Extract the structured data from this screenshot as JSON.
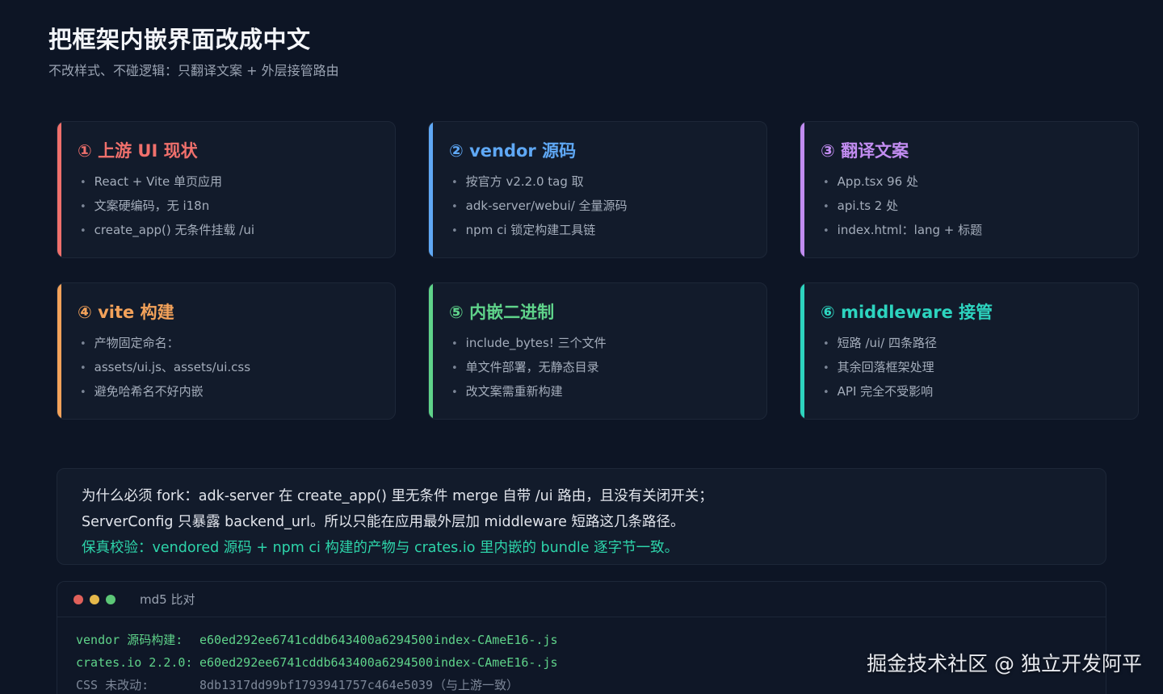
{
  "header": {
    "title": "把框架内嵌界面改成中文",
    "subtitle": "不改样式、不碰逻辑：只翻译文案 + 外层接管路由"
  },
  "cards": [
    {
      "title": "① 上游 UI 现状",
      "color": "#f0706c",
      "items": [
        "React + Vite 单页应用",
        "文案硬编码，无 i18n",
        "create_app() 无条件挂载 /ui"
      ]
    },
    {
      "title": "② vendor 源码",
      "color": "#5fa8f5",
      "items": [
        "按官方 v2.2.0 tag 取",
        "adk-server/webui/ 全量源码",
        "npm ci 锁定构建工具链"
      ]
    },
    {
      "title": "③ 翻译文案",
      "color": "#c18cf0",
      "items": [
        "App.tsx 96 处",
        "api.ts 2 处",
        "index.html：lang + 标题"
      ]
    },
    {
      "title": "④ vite 构建",
      "color": "#f3a25a",
      "items": [
        "产物固定命名：",
        "assets/ui.js、assets/ui.css",
        "避免哈希名不好内嵌"
      ]
    },
    {
      "title": "⑤ 内嵌二进制",
      "color": "#5fd38a",
      "items": [
        "include_bytes! 三个文件",
        "单文件部署，无静态目录",
        "改文案需重新构建"
      ]
    },
    {
      "title": "⑥ middleware 接管",
      "color": "#2dd4bf",
      "items": [
        "短路 /ui/ 四条路径",
        "其余回落框架处理",
        "API 完全不受影响"
      ]
    }
  ],
  "note": {
    "line1": "为什么必须 fork：adk-server 在 create_app() 里无条件 merge 自带 /ui 路由，且没有关闭开关；",
    "line2": "ServerConfig 只暴露 backend_url。所以只能在应用最外层加 middleware 短路这几条路径。",
    "line3": "保真校验：vendored 源码 + npm ci 构建的产物与 crates.io 里内嵌的 bundle 逐字节一致。"
  },
  "terminal": {
    "title": "md5 比对",
    "dot_colors": [
      "#e0605a",
      "#e5b84a",
      "#5cc777"
    ],
    "rows": [
      {
        "label": "vendor 源码构建:",
        "hash": "e60ed292ee6741cddb643400a6294500",
        "file": "index-CAmeE16-.js"
      },
      {
        "label": "crates.io 2.2.0:",
        "hash": "e60ed292ee6741cddb643400a6294500",
        "file": "index-CAmeE16-.js"
      },
      {
        "label": "CSS 未改动:",
        "hash": "8db1317dd99bf1793941757c464e5039",
        "file": "（与上游一致）"
      }
    ]
  },
  "watermark": "掘金技术社区 @ 独立开发阿平"
}
